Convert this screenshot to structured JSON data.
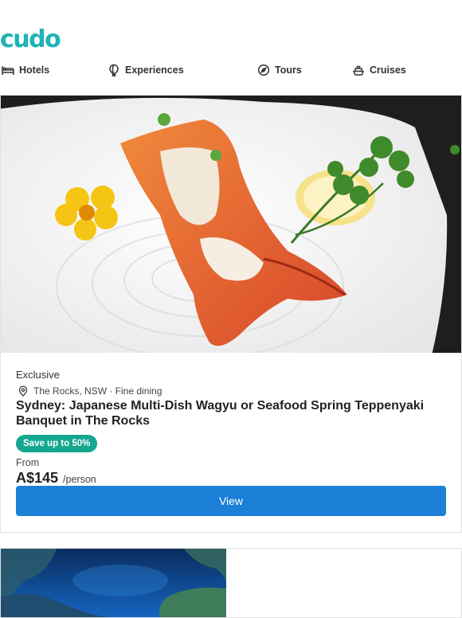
{
  "brand": {
    "logo_text": "cudo",
    "color": "#1eb3b7"
  },
  "nav": {
    "items": [
      {
        "label": "Hotels",
        "icon": "bed-icon"
      },
      {
        "label": "Experiences",
        "icon": "balloon-icon"
      },
      {
        "label": "Tours",
        "icon": "compass-icon"
      },
      {
        "label": "Cruises",
        "icon": "ship-icon"
      }
    ]
  },
  "deal": {
    "tag": "Exclusive",
    "location": "The Rocks, NSW · Fine dining",
    "title": "Sydney: Japanese Multi-Dish Wagyu or Seafood Spring Teppenyaki Banquet in The Rocks",
    "badge": "Save up to 50%",
    "from_label": "From",
    "price": "A$145",
    "price_unit": "/person",
    "button_label": "View",
    "colors": {
      "badge": "#15a78f",
      "button": "#1d80d8"
    }
  }
}
